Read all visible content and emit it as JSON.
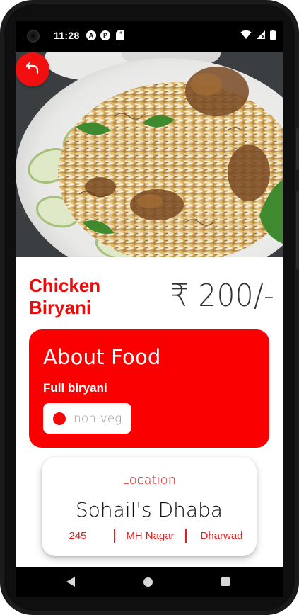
{
  "status_bar": {
    "time": "11:28",
    "notif_icons": [
      "a-icon",
      "p-icon",
      "sd-card-icon"
    ],
    "right_icons": [
      "wifi-icon",
      "signal-icon",
      "battery-icon"
    ]
  },
  "hero": {
    "image": "chicken-biryani-plate",
    "back_icon": "back-arrow-icon"
  },
  "food": {
    "name": "Chicken Biryani",
    "price": "₹ 200/-"
  },
  "about": {
    "title": "About Food",
    "description": "Full biryani",
    "type_label": "non-veg",
    "type_color": "#f20808"
  },
  "location": {
    "label": "Location",
    "name": "Sohail's Dhaba",
    "address": [
      "245",
      "MH Nagar",
      "Dharwad"
    ]
  },
  "nav": {
    "icons": [
      "nav-back-icon",
      "nav-home-icon",
      "nav-recents-icon"
    ]
  },
  "colors": {
    "accent": "#fb0000",
    "title": "#ee0b0b"
  }
}
